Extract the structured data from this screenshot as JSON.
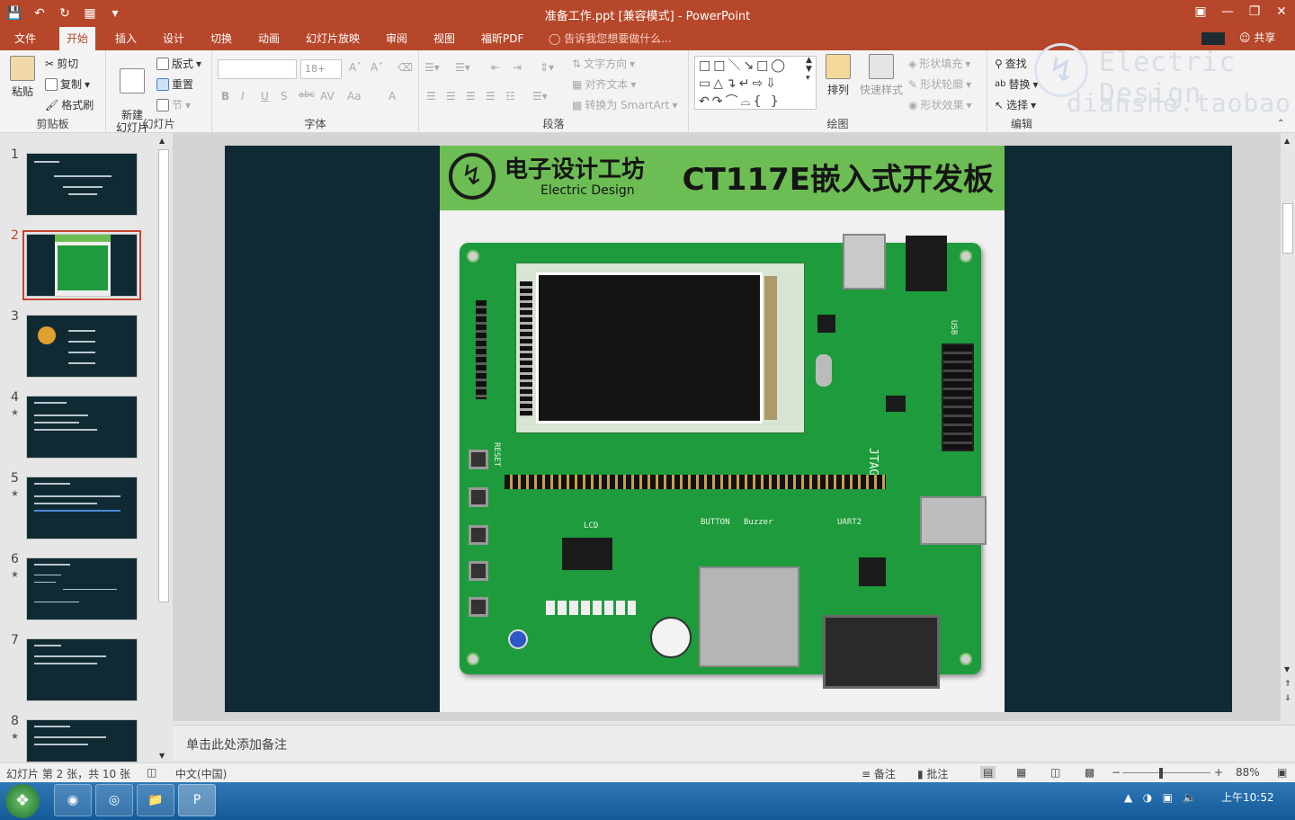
{
  "window": {
    "title": "准备工作.ppt [兼容模式] - PowerPoint"
  },
  "qat": {
    "save_icon": "save-icon",
    "undo_icon": "undo-icon",
    "redo_icon": "redo-icon",
    "present_icon": "present-icon"
  },
  "tabs": [
    "文件",
    "开始",
    "插入",
    "设计",
    "切换",
    "动画",
    "幻灯片放映",
    "审阅",
    "视图",
    "福昕PDF"
  ],
  "active_tab": "开始",
  "tellme": "告诉我您想要做什么...",
  "share": "共享",
  "ribbon": {
    "clipboard": {
      "paste": "粘贴",
      "cut": "剪切",
      "copy": "复制",
      "format_painter": "格式刷",
      "label": "剪贴板"
    },
    "slides": {
      "new_slide": "新建\n幻灯片",
      "layout": "版式",
      "reset": "重置",
      "section": "节",
      "label": "幻灯片"
    },
    "font": {
      "font_size": "18+",
      "label": "字体",
      "bold": "B",
      "italic": "I",
      "underline": "U",
      "shadow": "S",
      "strike": "abc",
      "spacing": "AV",
      "case": "Aa",
      "color": "A"
    },
    "paragraph": {
      "text_direction": "文字方向",
      "align_text": "对齐文本",
      "smartart": "转换为 SmartArt",
      "label": "段落"
    },
    "drawing": {
      "arrange": "排列",
      "quick_styles": "快速样式",
      "shape_fill": "形状填充",
      "shape_outline": "形状轮廓",
      "shape_effects": "形状效果",
      "label": "绘图"
    },
    "editing": {
      "find": "查找",
      "replace": "替换",
      "select": "选择",
      "label": "编辑"
    }
  },
  "watermark": {
    "line1": "Electric Design",
    "line2": "dianshe.taobao.com"
  },
  "thumbnails": [
    {
      "num": "1",
      "star": ""
    },
    {
      "num": "2",
      "star": ""
    },
    {
      "num": "3",
      "star": ""
    },
    {
      "num": "4",
      "star": "★"
    },
    {
      "num": "5",
      "star": "★"
    },
    {
      "num": "6",
      "star": "★"
    },
    {
      "num": "7",
      "star": ""
    },
    {
      "num": "8",
      "star": "★"
    }
  ],
  "slide": {
    "banner_cn": "电子设计工坊",
    "banner_en": "Electric Design",
    "banner_title": "CT117E嵌入式开发板",
    "silk": {
      "reset": "RESET",
      "lcd": "LCD",
      "button": "BUTTON",
      "buzzer": "Buzzer",
      "jtag": "JTAG",
      "usart": "UART2",
      "usb": "USB"
    }
  },
  "notes_placeholder": "单击此处添加备注",
  "status": {
    "slide_info": "幻灯片 第 2 张，共 10 张",
    "language": "中文(中国)",
    "notes": "备注",
    "comments": "批注",
    "zoom": "88%"
  },
  "taskbar": {
    "time": "上午10:52"
  },
  "colors": {
    "accent": "#b7472a",
    "slide_bg": "#0f2a33",
    "pcb": "#1e9b3c",
    "banner": "#6cbd54"
  }
}
